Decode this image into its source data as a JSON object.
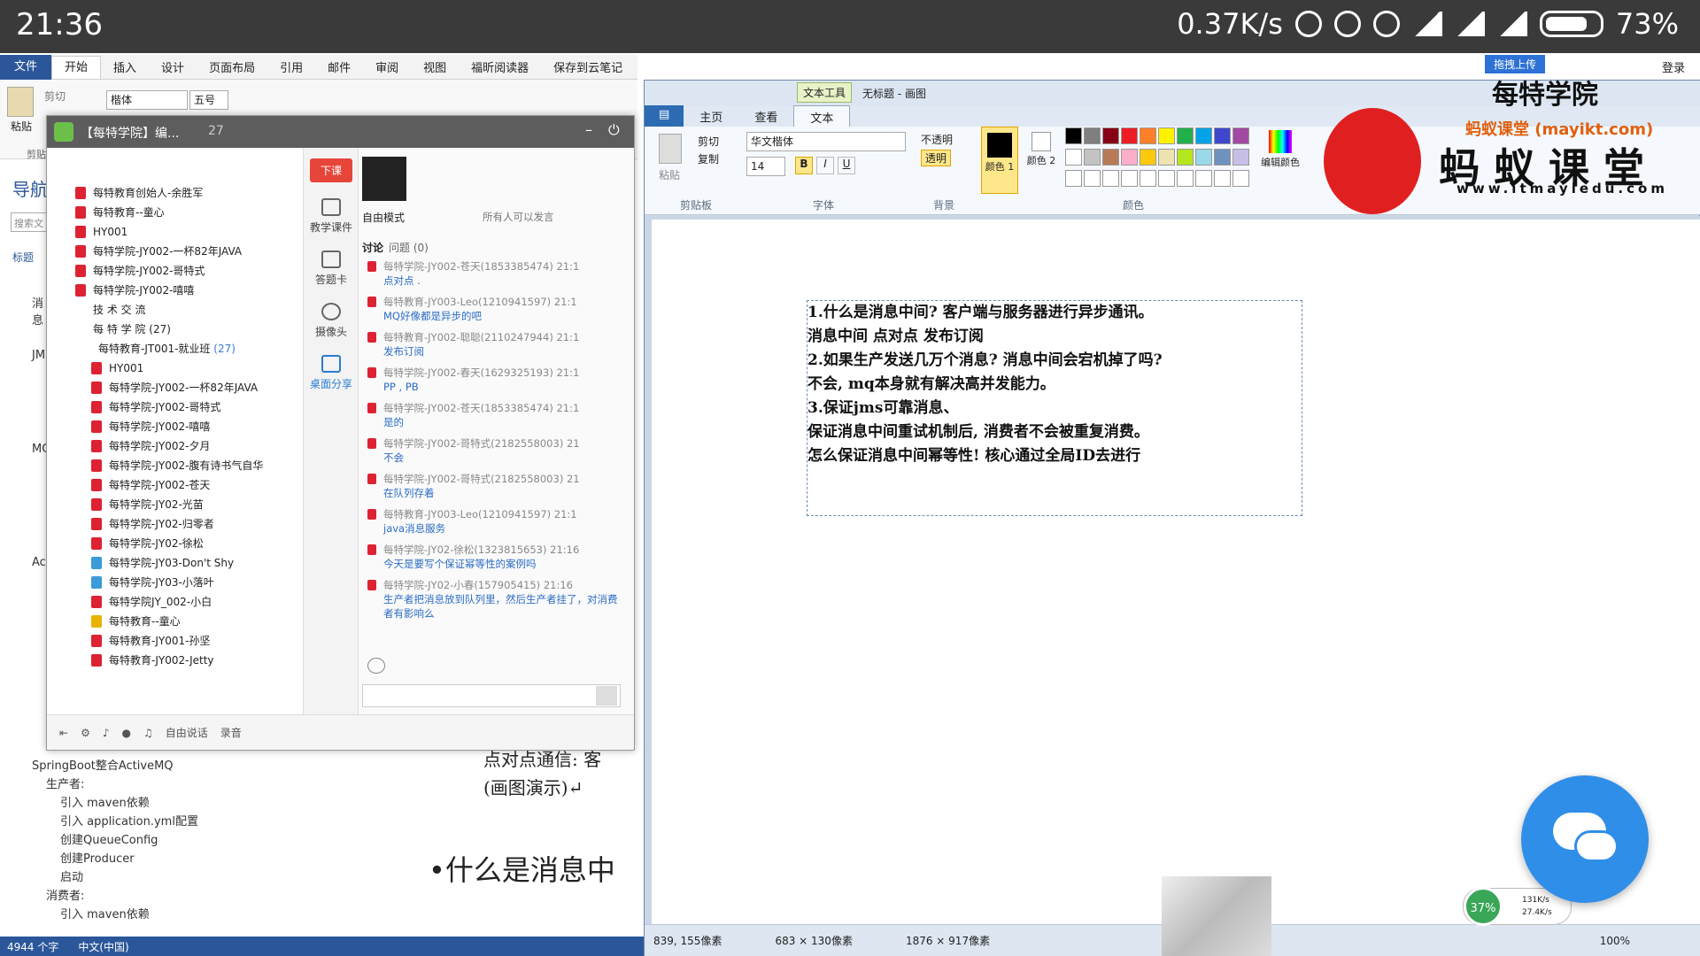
{
  "status_bar": {
    "time": "21:36",
    "speed": "0.37K/s",
    "battery": "73%"
  },
  "word": {
    "tabs": [
      "文件",
      "开始",
      "插入",
      "设计",
      "页面布局",
      "引用",
      "邮件",
      "审阅",
      "视图",
      "福昕阅读器",
      "保存到云笔记"
    ],
    "paste": "粘贴",
    "cut": "剪切",
    "clipboard": "剪贴",
    "font_name": "楷体",
    "font_size": "五号",
    "nav_title": "导航",
    "nav_search": "搜索文",
    "nav_heading": "标题",
    "nav_items": [
      "消息",
      "JM",
      "MC",
      "Act"
    ],
    "outline": [
      {
        "label": "SpringBoot整合ActiveMQ",
        "level": 0
      },
      {
        "label": "生产者:",
        "level": 1
      },
      {
        "label": "引入 maven依赖",
        "level": 2
      },
      {
        "label": "引入 application.yml配置",
        "level": 2
      },
      {
        "label": "创建QueueConfig",
        "level": 2
      },
      {
        "label": "创建Producer",
        "level": 2
      },
      {
        "label": "启动",
        "level": 2
      },
      {
        "label": "消费者:",
        "level": 1
      },
      {
        "label": "引入 maven依赖",
        "level": 2
      }
    ],
    "doc_line1": "点对点通信: 客",
    "doc_line2": "(画图演示)↵",
    "doc_heading": "•什么是消息中",
    "status": {
      "words": "4944 个字",
      "language": "中文(中国)"
    }
  },
  "qq": {
    "title": "【每特学院】编...",
    "count": "27",
    "top_members": [
      "每特教育创始人-余胜军",
      "每特教育--童心",
      "HY001",
      "每特学院-JY002-一杯82年JAVA",
      "每特学院-JY002-哥特式",
      "每特学院-JY002-嘻嘻"
    ],
    "groups": [
      "技 术 交 流",
      "每 特 学 院 (27)"
    ],
    "group_header": "每特教育-JT001-就业班",
    "group_count": "(27)",
    "members": [
      {
        "name": "HY001",
        "c": "r"
      },
      {
        "name": "每特学院-JY002-一杯82年JAVA",
        "c": "r"
      },
      {
        "name": "每特学院-JY002-哥特式",
        "c": "r"
      },
      {
        "name": "每特学院-JY002-嘻嘻",
        "c": "r"
      },
      {
        "name": "每特学院-JY002-夕月",
        "c": "r"
      },
      {
        "name": "每特学院-JY002-腹有诗书气自华",
        "c": "r"
      },
      {
        "name": "每特学院-JY002-苍天",
        "c": "r"
      },
      {
        "name": "每特学院-JY02-光苗",
        "c": "r"
      },
      {
        "name": "每特学院-JY02-归零者",
        "c": "r"
      },
      {
        "name": "每特学院-JY02-徐松",
        "c": "r"
      },
      {
        "name": "每特学院-JY03-Don't Shy",
        "c": "b"
      },
      {
        "name": "每特学院-JY03-小落叶",
        "c": "b"
      },
      {
        "name": "每特学院JY_002-小白",
        "c": "r"
      },
      {
        "name": "每特教育--童心",
        "c": "y"
      },
      {
        "name": "每特教育-JY001-孙坚",
        "c": "r"
      },
      {
        "name": "每特教育-JY002-Jetty",
        "c": "r"
      }
    ],
    "tools": [
      "下课",
      "教学课件",
      "答题卡",
      "摄像头",
      "桌面分享"
    ],
    "mode": "自由模式",
    "everyone": "所有人可以发言",
    "tab_discuss": "讨论",
    "tab_question": "问题 (0)",
    "messages": [
      {
        "who": "每特学院-JY002-苍天(1853385474) 21:1",
        "text": "点对点 ."
      },
      {
        "who": "每特教育-JY003-Leo(1210941597) 21:1",
        "text": "MQ好像都是异步的吧"
      },
      {
        "who": "每特教育-JY002-聪聪(2110247944) 21:1",
        "text": "发布订阅"
      },
      {
        "who": "每特学院-JY002-春天(1629325193) 21:1",
        "text": "PP , PB"
      },
      {
        "who": "每特学院-JY002-苍天(1853385474) 21:1",
        "text": "是的"
      },
      {
        "who": "每特学院-JY002-哥特式(2182558003) 21",
        "text": "不会"
      },
      {
        "who": "每特学院-JY002-哥特式(2182558003) 21",
        "text": "在队列存着"
      },
      {
        "who": "每特教育-JY003-Leo(1210941597) 21:1",
        "text": "java消息服务"
      },
      {
        "who": "每特学院-JY02-徐松(1323815653) 21:16",
        "text": "今天是要写个保证幂等性的案例吗"
      },
      {
        "who": "每特学院-JY02-小春(157905415) 21:16",
        "text": "生产者把消息放到队列里，然后生产者挂了，对消费者有影响么"
      }
    ],
    "bottom": {
      "free_speak": "自由说话",
      "record": "录音"
    }
  },
  "paint": {
    "context_tab": "文本工具",
    "title": "无标题 - 画图",
    "tabs": [
      "主页",
      "查看",
      "文本"
    ],
    "clipboard": {
      "paste": "粘贴",
      "cut": "剪切",
      "copy": "复制",
      "label": "剪贴板"
    },
    "font": {
      "name": "华文楷体",
      "size": "14",
      "label": "字体"
    },
    "background": {
      "opaque": "不透明",
      "transparent": "透明",
      "label": "背景"
    },
    "colors": {
      "color1": "颜色 1",
      "color2": "颜色 2",
      "edit": "编辑颜色",
      "label": "颜色"
    },
    "text_lines": [
      "1.什么是消息中间? 客户端与服务器进行异步通讯。",
      "消息中间 点对点 发布订阅",
      "2.如果生产发送几万个消息? 消息中间会宕机掉了吗?",
      "  不会, mq本身就有解决高并发能力。",
      "3.保证jms可靠消息、",
      "保证消息中间重试机制后, 消费者不会被重复消费。",
      "怎么保证消息中间幂等性! 核心通过全局ID去进行"
    ],
    "status": {
      "cursor": "839, 155像素",
      "selection": "683 × 130像素",
      "canvas": "1876 × 917像素",
      "zoom": "100%"
    }
  },
  "brand": {
    "name": "每特学院",
    "site": "蚂蚁课堂 (mayikt.com)",
    "big": "蚂 蚁 课 堂",
    "url": "www.itmayiedu.com",
    "login": "登录",
    "upload": "拖拽上传"
  },
  "widgets": {
    "percent": "37%",
    "up": "131K/s",
    "down": "27.4K/s"
  },
  "palette": [
    "#000000",
    "#7f7f7f",
    "#880015",
    "#ed1c24",
    "#ff7f27",
    "#fff200",
    "#22b14c",
    "#00a2e8",
    "#3f48cc",
    "#a349a4",
    "#ffffff",
    "#c3c3c3",
    "#b97a57",
    "#ffaec9",
    "#ffc90e",
    "#efe4b0",
    "#b5e61d",
    "#99d9ea",
    "#7092be",
    "#c8bfe7"
  ]
}
